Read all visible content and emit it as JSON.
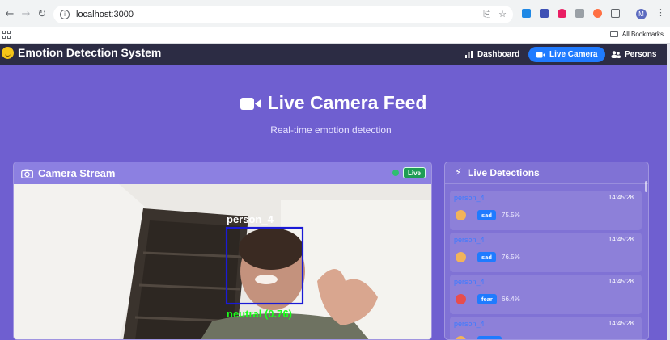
{
  "browser": {
    "url": "localhost:3000",
    "bookmarks_label": "All Bookmarks",
    "profile_initial": "M"
  },
  "app": {
    "brand": "Emotion Detection System",
    "nav": [
      {
        "label": "Dashboard",
        "icon": "bar-chart-icon",
        "active": false
      },
      {
        "label": "Live Camera",
        "icon": "video-icon",
        "active": true
      },
      {
        "label": "Persons",
        "icon": "users-icon",
        "active": false
      }
    ]
  },
  "hero": {
    "title": "Live Camera Feed",
    "subtitle": "Real-time emotion detection"
  },
  "camera_panel": {
    "title": "Camera Stream",
    "status": "Live",
    "overlay_label": "person_4",
    "overlay_result": "neutral (0.76)"
  },
  "detections_panel": {
    "title": "Live Detections",
    "items": [
      {
        "person": "person_4",
        "time": "14:45:28",
        "emotion": "sad",
        "confidence": "75.5%",
        "emoji": "sad-face"
      },
      {
        "person": "person_4",
        "time": "14:45:28",
        "emotion": "sad",
        "confidence": "76.5%",
        "emoji": "sad-face"
      },
      {
        "person": "person_4",
        "time": "14:45:28",
        "emotion": "fear",
        "confidence": "66.4%",
        "emoji": "fear-face"
      },
      {
        "person": "person_4",
        "time": "14:45:28",
        "emotion": "",
        "confidence": "",
        "emoji": "sad-face"
      }
    ]
  },
  "colors": {
    "accent": "#1f7bff",
    "header": "#2c2c44",
    "live": "#1f9d55",
    "box": "#1a1ad6",
    "result": "#1aff1a"
  }
}
